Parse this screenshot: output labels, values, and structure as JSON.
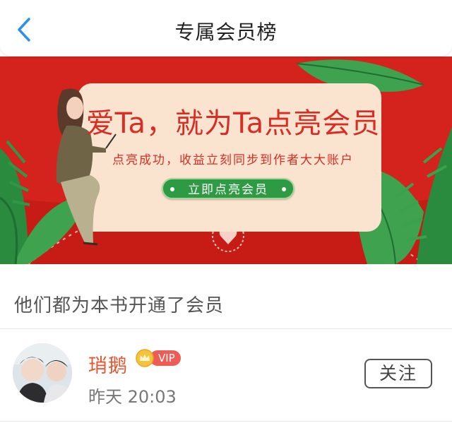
{
  "header": {
    "title": "专属会员榜",
    "back_icon": "chevron-left-icon",
    "accent_color": "#2c8ff0"
  },
  "banner": {
    "headline": "爱Ta，就为Ta点亮会员",
    "subtitle": "点亮成功，收益立刻同步到作者大大账户",
    "cta_label": "立即点亮会员",
    "background_color": "#d3231c",
    "cta_color": "#2e9a43"
  },
  "section": {
    "title": "他们都为本书开通了会员"
  },
  "members": [
    {
      "name": "琑鹅",
      "badge": "VIP",
      "time": "昨天 20:03",
      "follow_label": "关注",
      "name_color": "#e5542c"
    }
  ]
}
